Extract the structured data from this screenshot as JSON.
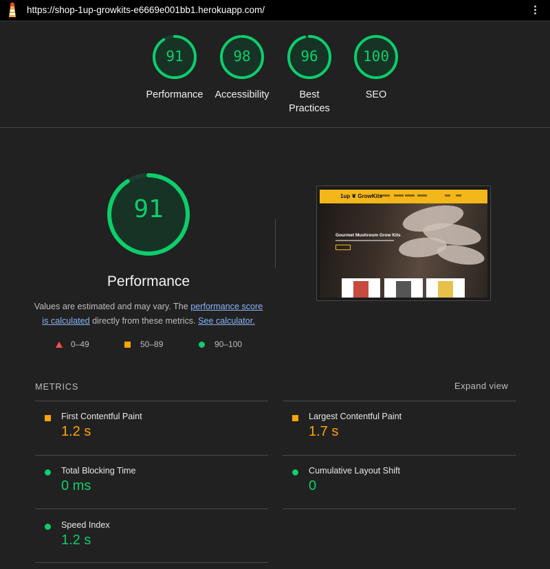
{
  "browser": {
    "url": "https://shop-1up-growkits-e6669e001bb1.herokuapp.com/",
    "lighthouse_icon": "lighthouse-icon",
    "menu_icon": "kebab-menu-icon"
  },
  "summary_gauges": [
    {
      "score": "91",
      "label": "Performance",
      "color": "#0cce6b"
    },
    {
      "score": "98",
      "label": "Accessibility",
      "color": "#0cce6b"
    },
    {
      "score": "96",
      "label": "Best Practices",
      "color": "#0cce6b"
    },
    {
      "score": "100",
      "label": "SEO",
      "color": "#0cce6b"
    }
  ],
  "performance": {
    "score": "91",
    "title": "Performance",
    "desc_prefix": "Values are estimated and may vary. The ",
    "desc_link1": "performance score is calculated",
    "desc_middle": " directly from these metrics. ",
    "desc_link2": "See calculator."
  },
  "legend": {
    "fail": "0–49",
    "average": "50–89",
    "pass": "90–100",
    "colors": {
      "fail": "#ff4e42",
      "average": "#ffa400",
      "pass": "#0cce6b"
    }
  },
  "screenshot": {
    "logo": "1up ❦ GrowKits",
    "heading": "Gourmet Mushroom Grow Kits"
  },
  "metrics": {
    "header": "METRICS",
    "expand": "Expand view",
    "items": [
      {
        "name": "First Contentful Paint",
        "value": "1.2 s",
        "status": "average"
      },
      {
        "name": "Largest Contentful Paint",
        "value": "1.7 s",
        "status": "average"
      },
      {
        "name": "Total Blocking Time",
        "value": "0 ms",
        "status": "pass"
      },
      {
        "name": "Cumulative Layout Shift",
        "value": "0",
        "status": "pass"
      },
      {
        "name": "Speed Index",
        "value": "1.2 s",
        "status": "pass"
      }
    ]
  }
}
